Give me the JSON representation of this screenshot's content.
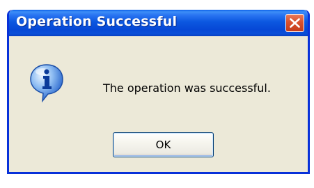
{
  "window": {
    "title": "Operation Successful",
    "close_icon": "close-icon"
  },
  "body": {
    "icon": "info-icon",
    "message": "The operation was successful."
  },
  "buttons": {
    "ok_label": "OK"
  },
  "colors": {
    "titlebar": "#0a4fd8",
    "dialog_background": "#ece9d8",
    "close_button": "#d9512e"
  }
}
